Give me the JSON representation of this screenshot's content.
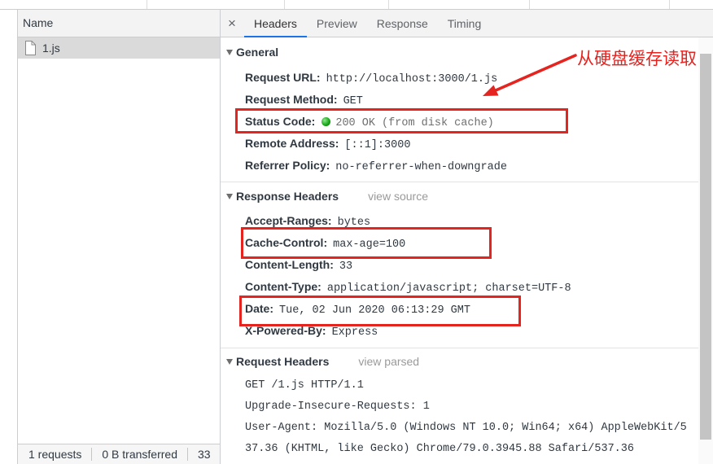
{
  "colors": {
    "accent": "#1a73e8",
    "annotation_red": "#e5231f",
    "status_green": "#1aa81a",
    "selected_row": "#dadada"
  },
  "annotation": {
    "text": "从硬盘缓存读取"
  },
  "left_panel": {
    "column_header": "Name",
    "requests": [
      {
        "name": "1.js",
        "icon": "file-icon",
        "selected": true
      }
    ],
    "status_bar": {
      "requests": "1 requests",
      "transferred": "0 B transferred",
      "resources": "33"
    }
  },
  "detail_tabs": {
    "close": "×",
    "items": [
      {
        "label": "Headers",
        "active": true
      },
      {
        "label": "Preview",
        "active": false
      },
      {
        "label": "Response",
        "active": false
      },
      {
        "label": "Timing",
        "active": false
      }
    ]
  },
  "general": {
    "title": "General",
    "expanded": true,
    "rows": [
      {
        "key": "Request URL:",
        "value": "http://localhost:3000/1.js"
      },
      {
        "key": "Request Method:",
        "value": "GET"
      },
      {
        "key": "Status Code:",
        "value": "200 OK (from disk cache)",
        "indicator": "green-dot-icon",
        "highlighted": true
      },
      {
        "key": "Remote Address:",
        "value": "[::1]:3000"
      },
      {
        "key": "Referrer Policy:",
        "value": "no-referrer-when-downgrade"
      }
    ]
  },
  "response_headers": {
    "title": "Response Headers",
    "toggle_link": "view source",
    "expanded": true,
    "rows": [
      {
        "key": "Accept-Ranges:",
        "value": "bytes"
      },
      {
        "key": "Cache-Control:",
        "value": "max-age=100",
        "highlighted": true
      },
      {
        "key": "Content-Length:",
        "value": "33"
      },
      {
        "key": "Content-Type:",
        "value": "application/javascript; charset=UTF-8"
      },
      {
        "key": "Date:",
        "value": "Tue, 02 Jun 2020 06:13:29 GMT",
        "highlighted": true
      },
      {
        "key": "X-Powered-By:",
        "value": "Express"
      }
    ]
  },
  "request_headers": {
    "title": "Request Headers",
    "toggle_link": "view parsed",
    "expanded": true,
    "raw_lines": [
      "GET /1.js HTTP/1.1",
      "Upgrade-Insecure-Requests: 1",
      "User-Agent: Mozilla/5.0 (Windows NT 10.0; Win64; x64) AppleWebKit/5",
      "37.36 (KHTML, like Gecko) Chrome/79.0.3945.88 Safari/537.36"
    ]
  }
}
